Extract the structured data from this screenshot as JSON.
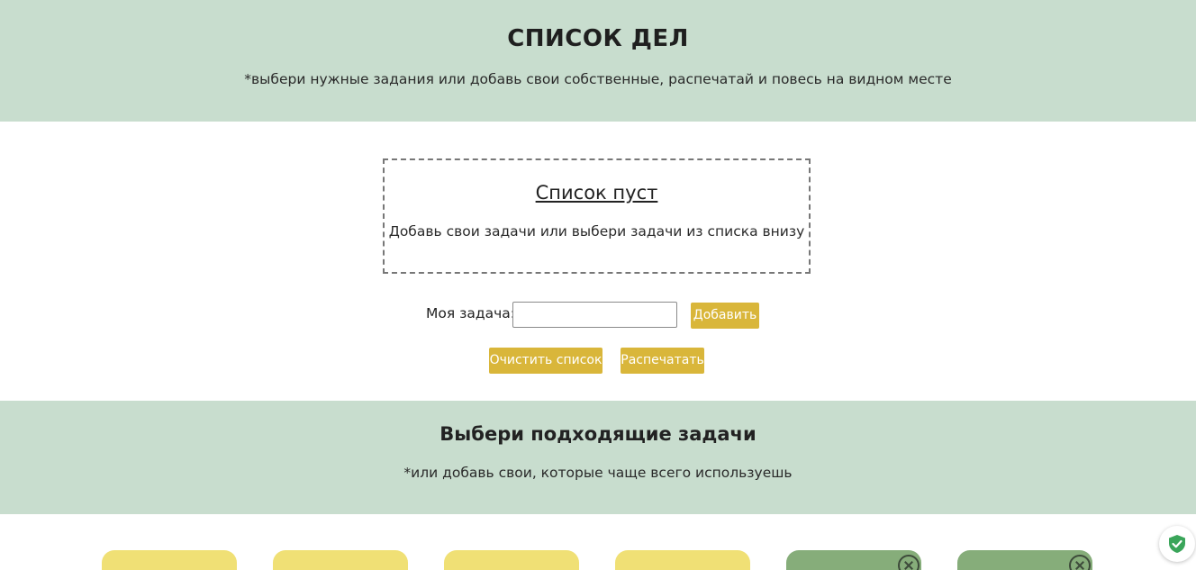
{
  "header": {
    "title": "СПИСОК ДЕЛ",
    "subtitle": "*выбери нужные задания или добавь свои собственные, распечатай и повесь на видном месте"
  },
  "empty_state": {
    "title": "Список пуст",
    "text": "Добавь свои задачи или выбери задачи из списка внизу"
  },
  "task_form": {
    "label": "Моя задача:",
    "input_value": "",
    "add_label": "Добавить"
  },
  "actions": {
    "clear_label": "Очистить список",
    "print_label": "Распечатать"
  },
  "choose": {
    "title": "Выбери подходящие задачи",
    "subtitle": "*или добавь свои, которые чаще всего используешь"
  },
  "cards": [
    {
      "color": "yellow",
      "removable": false
    },
    {
      "color": "yellow",
      "removable": false
    },
    {
      "color": "yellow",
      "removable": false
    },
    {
      "color": "yellow",
      "removable": false
    },
    {
      "color": "green",
      "removable": true
    },
    {
      "color": "green",
      "removable": true
    }
  ],
  "colors": {
    "band": "#c8ddce",
    "button": "#d9b63a",
    "card_yellow": "#f0e075",
    "card_green": "#86ad7a",
    "shield": "#3aa55a"
  },
  "icons": {
    "card_close": "close-circle-icon",
    "floating_badge": "shield-check-icon"
  }
}
